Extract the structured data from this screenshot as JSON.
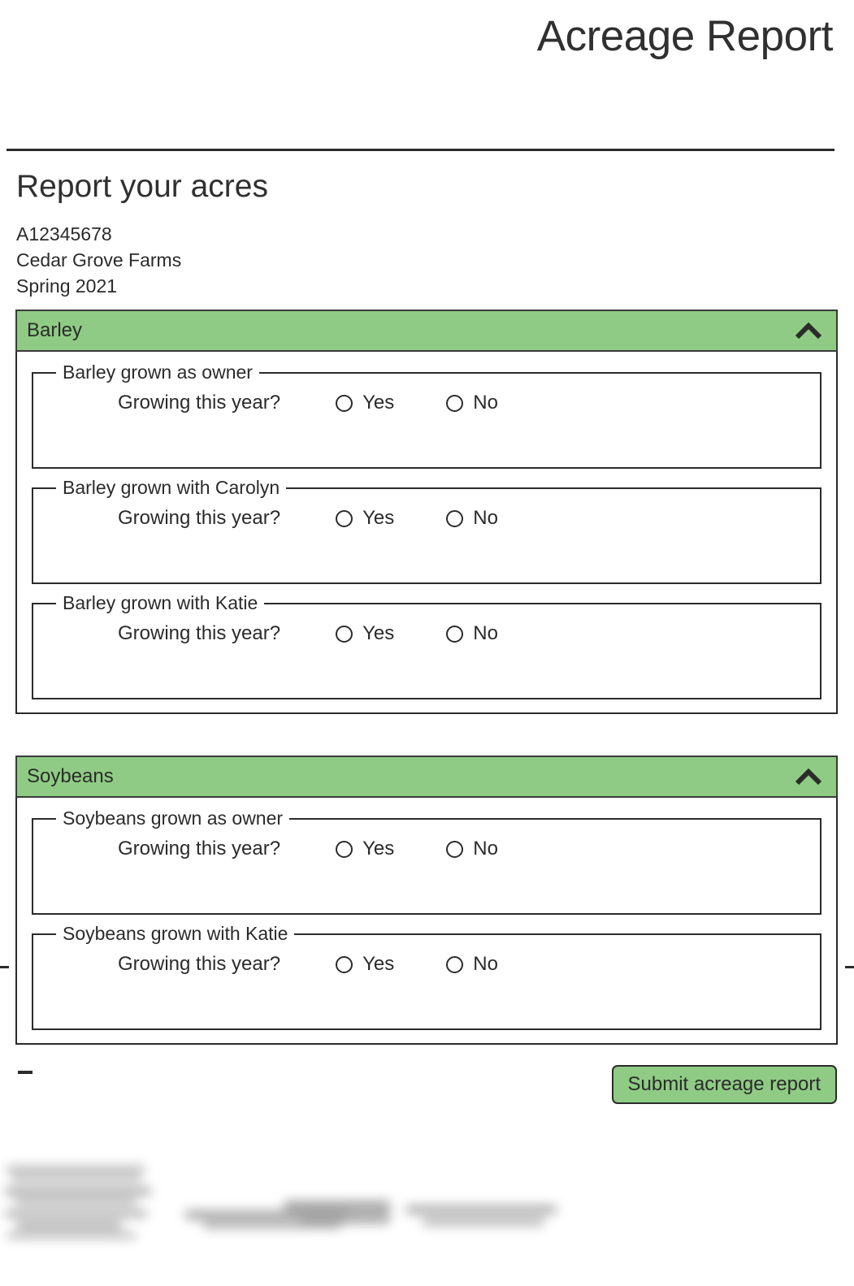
{
  "app": {
    "title": "Acreage Report"
  },
  "page": {
    "heading": "Report your acres",
    "contract_id": "A12345678",
    "farm_name": "Cedar Grove Farms",
    "season": "Spring 2021"
  },
  "colors": {
    "accent_green": "#8fcb84",
    "border_dark": "#2b2b2b",
    "text": "#2b2b2b"
  },
  "question_label": "Growing this year?",
  "radio_options": [
    {
      "label": "Yes",
      "value": "yes",
      "selected": false
    },
    {
      "label": "No",
      "value": "no",
      "selected": false
    }
  ],
  "sections": [
    {
      "title": "Barley",
      "expanded": true,
      "toggle_icon": "chevron-up-icon",
      "parties": [
        {
          "legend": "Barley grown as owner"
        },
        {
          "legend": "Barley grown with Carolyn"
        },
        {
          "legend": "Barley grown with Katie"
        }
      ]
    },
    {
      "title": "Soybeans",
      "expanded": true,
      "toggle_icon": "chevron-up-icon",
      "parties": [
        {
          "legend": "Soybeans grown as owner"
        },
        {
          "legend": "Soybeans grown with Katie"
        }
      ]
    }
  ],
  "footer": {
    "submit_label": "Submit acreage report"
  }
}
